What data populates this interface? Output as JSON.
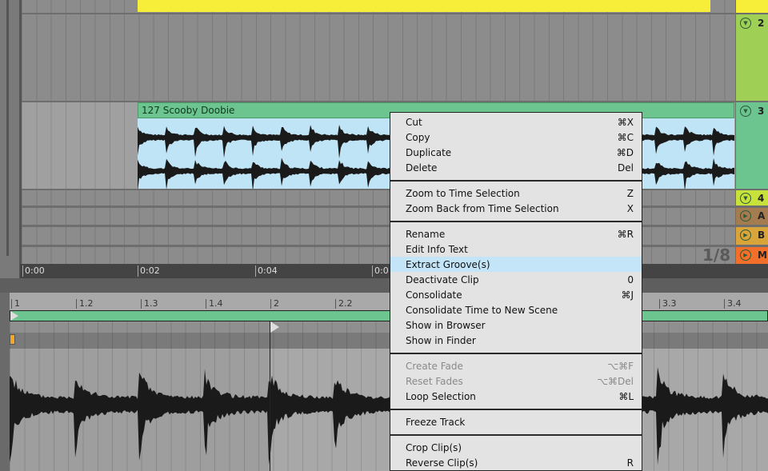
{
  "arrangement": {
    "clip": {
      "name": "127 Scooby Doobie",
      "header_color": "#6cc48f",
      "wave_bg": "#bfe4f6"
    },
    "top_clip_color": "#f7ee3a",
    "tracks": [
      {
        "label": "2",
        "color": "#9fcf55",
        "icon": "fold-triangle-icon"
      },
      {
        "label": "3",
        "color": "#6cc48f",
        "icon": "fold-triangle-icon"
      },
      {
        "label": "4",
        "color": "#c9e23b",
        "icon": "fold-triangle-icon"
      },
      {
        "label": "A",
        "color": "#a57b50",
        "icon": "play-triangle-icon"
      },
      {
        "label": "B",
        "color": "#d9a43a",
        "icon": "play-triangle-icon"
      },
      {
        "label": "M",
        "color": "#f2702a",
        "icon": "play-triangle-icon"
      }
    ],
    "grid_quantization": "1/8",
    "time_ruler": [
      "0:00",
      "0:02",
      "0:04",
      "0:0"
    ]
  },
  "clip_editor": {
    "beat_ruler": [
      "1",
      "1.2",
      "1.3",
      "1.4",
      "2",
      "2.2",
      "3.3",
      "3.4"
    ],
    "loop_color": "#6cc48f"
  },
  "context_menu": {
    "groups": [
      [
        {
          "label": "Cut",
          "shortcut": "⌘X"
        },
        {
          "label": "Copy",
          "shortcut": "⌘C"
        },
        {
          "label": "Duplicate",
          "shortcut": "⌘D"
        },
        {
          "label": "Delete",
          "shortcut": "Del"
        }
      ],
      [
        {
          "label": "Zoom to Time Selection",
          "shortcut": "Z"
        },
        {
          "label": "Zoom Back from Time Selection",
          "shortcut": "X"
        }
      ],
      [
        {
          "label": "Rename",
          "shortcut": "⌘R"
        },
        {
          "label": "Edit Info Text",
          "shortcut": ""
        },
        {
          "label": "Extract Groove(s)",
          "shortcut": "",
          "highlighted": true
        },
        {
          "label": "Deactivate Clip",
          "shortcut": "0"
        },
        {
          "label": "Consolidate",
          "shortcut": "⌘J"
        },
        {
          "label": "Consolidate Time to New Scene",
          "shortcut": ""
        },
        {
          "label": "Show in Browser",
          "shortcut": ""
        },
        {
          "label": "Show in Finder",
          "shortcut": ""
        }
      ],
      [
        {
          "label": "Create Fade",
          "shortcut": "⌥⌘F",
          "disabled": true
        },
        {
          "label": "Reset Fades",
          "shortcut": "⌥⌘Del",
          "disabled": true
        },
        {
          "label": "Loop Selection",
          "shortcut": "⌘L"
        }
      ],
      [
        {
          "label": "Freeze Track",
          "shortcut": ""
        }
      ],
      [
        {
          "label": "Crop Clip(s)",
          "shortcut": ""
        },
        {
          "label": "Reverse Clip(s)",
          "shortcut": "R"
        }
      ]
    ]
  }
}
